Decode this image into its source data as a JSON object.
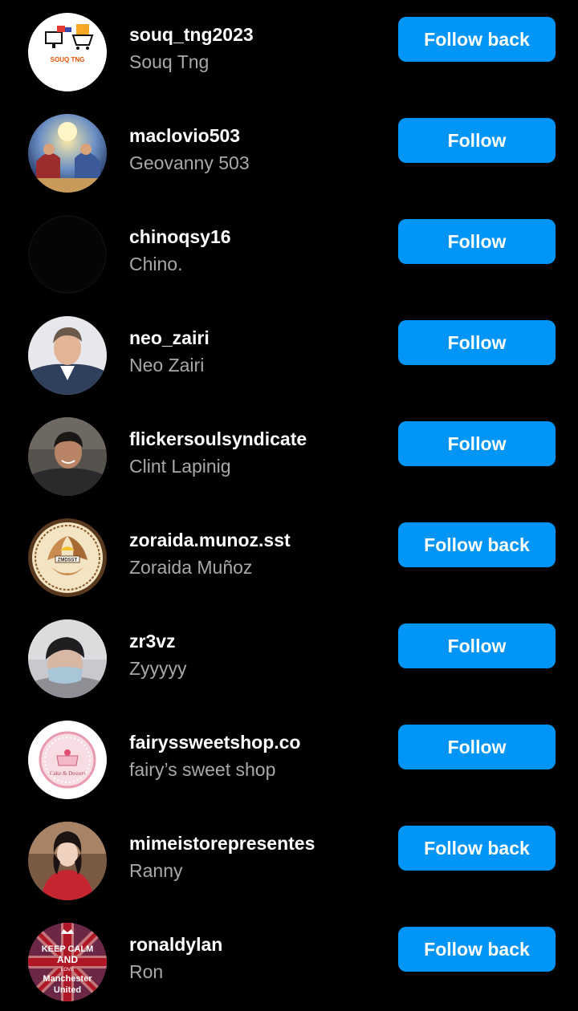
{
  "theme": {
    "background": "#000000",
    "button_color": "#0095f6",
    "secondary_text": "#a8a8a8"
  },
  "rows": [
    {
      "username": "souq_tng2023",
      "fullname": "Souq Tng",
      "button": "Follow back",
      "avatar": "souq-tng-logo-avatar",
      "avatar_text": "SOUQ TNG"
    },
    {
      "username": "maclovio503",
      "fullname": "Geovanny 503",
      "button": "Follow",
      "avatar": "religious-painting-avatar"
    },
    {
      "username": "chinoqsy16",
      "fullname": "Chino.",
      "button": "Follow",
      "avatar": "black-avatar"
    },
    {
      "username": "neo_zairi",
      "fullname": "Neo Zairi",
      "button": "Follow",
      "avatar": "person-avatar"
    },
    {
      "username": "flickersoulsyndicate",
      "fullname": "Clint Lapinig",
      "button": "Follow",
      "avatar": "person-avatar"
    },
    {
      "username": "zoraida.munoz.sst",
      "fullname": "Zoraida Muñoz",
      "button": "Follow back",
      "avatar": "zmdsst-logo-avatar",
      "avatar_text": "ZMDSST"
    },
    {
      "username": "zr3vz",
      "fullname": "Zyyyyy",
      "button": "Follow",
      "avatar": "person-avatar"
    },
    {
      "username": "fairyssweetshop.co",
      "fullname": "fairy’s sweet shop",
      "button": "Follow",
      "avatar": "sweet-shop-logo-avatar",
      "avatar_text": "Cake & Dessert"
    },
    {
      "username": "mimeistorepresentes",
      "fullname": "Ranny",
      "button": "Follow back",
      "avatar": "person-avatar"
    },
    {
      "username": "ronaldylan",
      "fullname": "Ron",
      "button": "Follow back",
      "avatar": "keep-calm-avatar",
      "avatar_text": [
        "KEEP CALM",
        "AND",
        "LOVE",
        "Manchester",
        "United"
      ]
    }
  ]
}
